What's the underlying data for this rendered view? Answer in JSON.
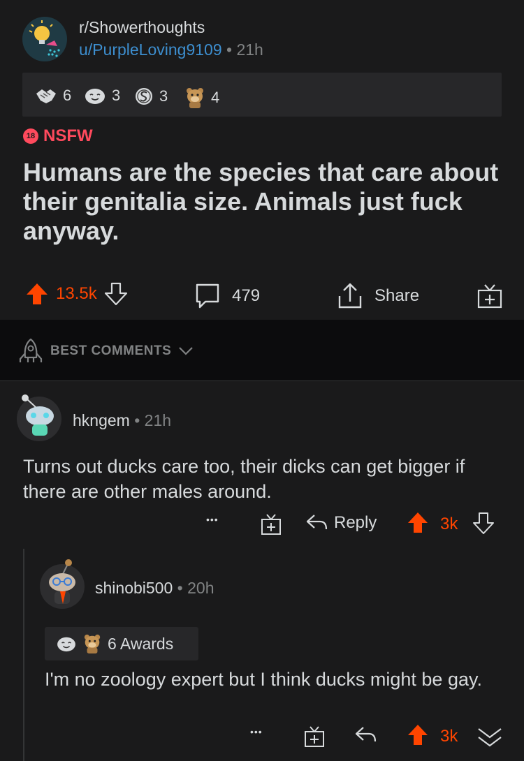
{
  "post": {
    "subreddit": "r/Showerthoughts",
    "author": "u/PurpleLoving9109",
    "dot": "•",
    "time": "21h",
    "awards": [
      {
        "icon": "handshake-icon",
        "count": "6"
      },
      {
        "icon": "wholesome-icon",
        "count": "3"
      },
      {
        "icon": "silver-icon",
        "count": "3"
      },
      {
        "icon": "bear-icon",
        "count": "4"
      }
    ],
    "nsfw_badge": "18",
    "nsfw_label": "NSFW",
    "title": "Humans are the species that care about their genitalia size. Animals just fuck anyway.",
    "votes": "13.5k",
    "comments": "479",
    "share": "Share"
  },
  "sort": {
    "label": "BEST COMMENTS"
  },
  "comments": [
    {
      "user": "hkngem",
      "dot": "•",
      "time": "21h",
      "body": "Turns out ducks care too, their dicks can get bigger if there are other males around.",
      "more": "•••",
      "reply": "Reply",
      "votes": "3k"
    },
    {
      "user": "shinobi500",
      "dot": "•",
      "time": "20h",
      "awards_label": "6 Awards",
      "body": "I'm no zoology expert but I think ducks might be gay.",
      "more": "•••",
      "votes": "3k"
    }
  ],
  "colors": {
    "upvote": "#ff4500",
    "link": "#3d8ecf",
    "nsfw": "#ff4a5d",
    "background": "#1a1a1b"
  }
}
